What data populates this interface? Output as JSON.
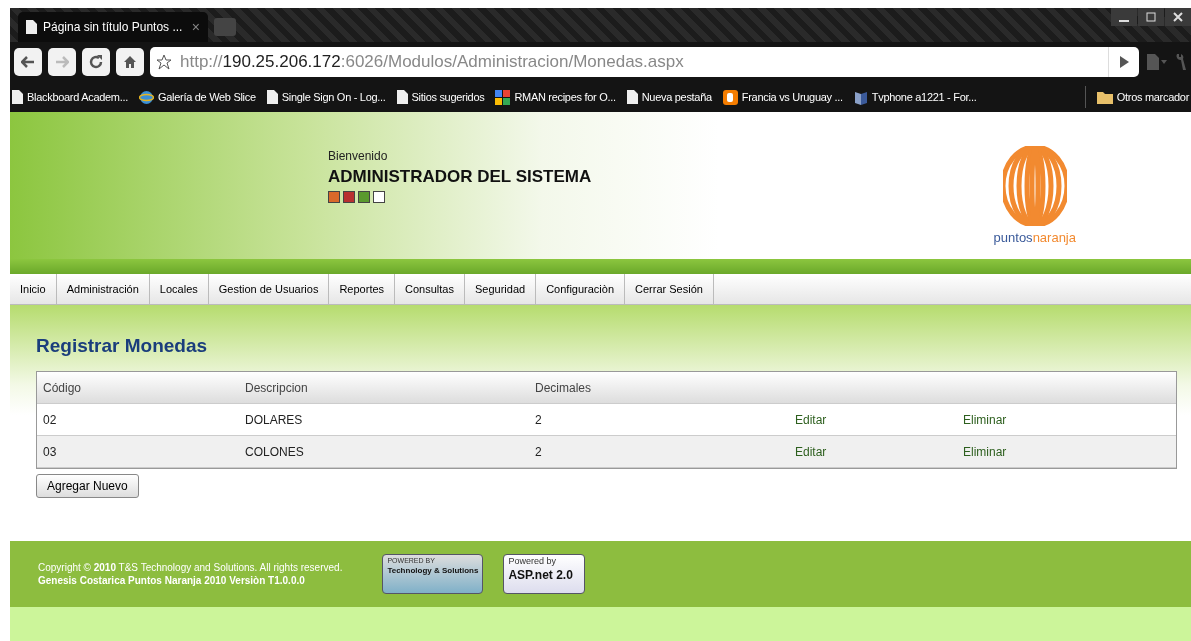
{
  "browser": {
    "tab": {
      "title": "Página sin título Puntos ...",
      "close": "×"
    },
    "url": {
      "scheme": "http://",
      "host": "190.25.206.172",
      "rest": ":6026/Modulos/Administracion/Monedas.aspx"
    },
    "bookmarks": [
      {
        "kind": "page",
        "label": "Blackboard Academ..."
      },
      {
        "kind": "ie",
        "label": "Galería de Web Slice"
      },
      {
        "kind": "page",
        "label": "Single Sign On - Log..."
      },
      {
        "kind": "page",
        "label": "Sitios sugeridos"
      },
      {
        "kind": "google",
        "label": "RMAN recipes for O..."
      },
      {
        "kind": "page",
        "label": "Nueva pestaña"
      },
      {
        "kind": "blogger",
        "label": "Francia vs Uruguay ..."
      },
      {
        "kind": "tv",
        "label": "Tvphone a1221 - For..."
      }
    ],
    "other_bookmarks": "Otros marcador"
  },
  "header": {
    "greeting": "Bienvenido",
    "user": "ADMINISTRADOR DEL SISTEMA",
    "swatches": [
      {
        "color": "#d9692a"
      },
      {
        "color": "#b83030"
      },
      {
        "color": "#5a9a2e"
      },
      {
        "color": "#ffffff"
      }
    ],
    "logo": {
      "part_1": "puntos",
      "part_2": "naranja"
    }
  },
  "menu": [
    {
      "label": "Inicio"
    },
    {
      "label": "Administración"
    },
    {
      "label": "Locales"
    },
    {
      "label": "Gestion de Usuarios"
    },
    {
      "label": "Reportes"
    },
    {
      "label": "Consultas"
    },
    {
      "label": "Seguridad"
    },
    {
      "label": "Configuraciòn"
    },
    {
      "label": "Cerrar Sesión"
    }
  ],
  "page_title": "Registrar Monedas",
  "table": {
    "columns": [
      "Código",
      "Descripcion",
      "Decimales"
    ],
    "rows": [
      {
        "cells": [
          "02",
          "DOLARES",
          "2"
        ],
        "edit": "Editar",
        "delete": "Eliminar"
      },
      {
        "cells": [
          "03",
          "COLONES",
          "2"
        ],
        "edit": "Editar",
        "delete": "Eliminar"
      }
    ]
  },
  "add_button": "Agregar Nuevo",
  "footer": {
    "copyright": "Copyright ©  **2010**  T&S Technology and Solutions. All rights reserved.",
    "version": "Genesis Costarica Puntos Naranja 2010 Versiòn T1.0.0.0",
    "badge_1": {
      "top": "POWERED BY",
      "main": "Technology & Solutions"
    },
    "badge_2": {
      "top": "Powered by",
      "main": "ASP.net 2.0"
    }
  }
}
